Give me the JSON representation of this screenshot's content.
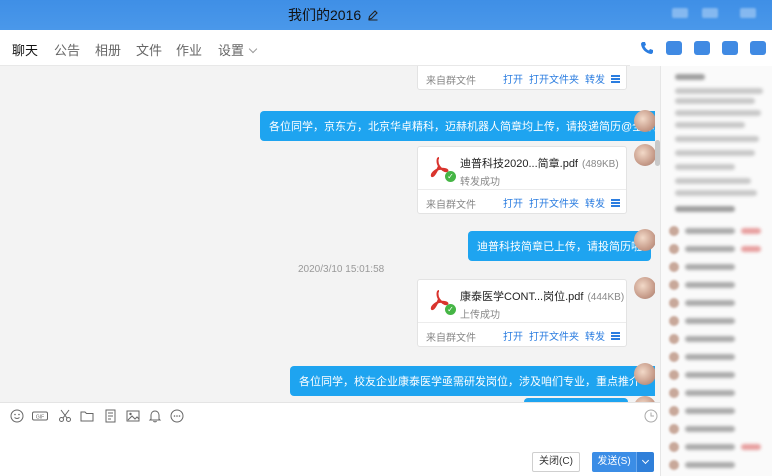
{
  "window": {
    "title": "我们的2016"
  },
  "tabs": [
    {
      "label": "聊天"
    },
    {
      "label": "公告"
    },
    {
      "label": "相册"
    },
    {
      "label": "文件"
    },
    {
      "label": "作业"
    },
    {
      "label": "设置"
    }
  ],
  "messages": {
    "file_source": "来自群文件",
    "actions": {
      "open": "打开",
      "open_folder": "打开文件夹",
      "forward": "转发"
    },
    "bubble1": "各位同学，京东方，北京华卓精科，迈赫机器人简章均上传，请投递简历@全体成员",
    "file1": {
      "name": "迪普科技2020...简章.pdf",
      "size": "(489KB)",
      "status": "转发成功"
    },
    "bubble2": "迪普科技简章已上传，请投简历啦",
    "timestamp": "2020/3/10 15:01:58",
    "file2": {
      "name": "康泰医学CONT...岗位.pdf",
      "size": "(444KB)",
      "status": "上传成功"
    },
    "bubble3": "各位同学，校友企业康泰医学亟需研发岗位，涉及咱们专业，重点推介一下。"
  },
  "buttons": {
    "close": "关闭(C)",
    "send": "发送(S)"
  },
  "colors": {
    "accent": "#2b7de0",
    "bubble": "#1ea4f0",
    "titlebar": "#4a98ea"
  }
}
